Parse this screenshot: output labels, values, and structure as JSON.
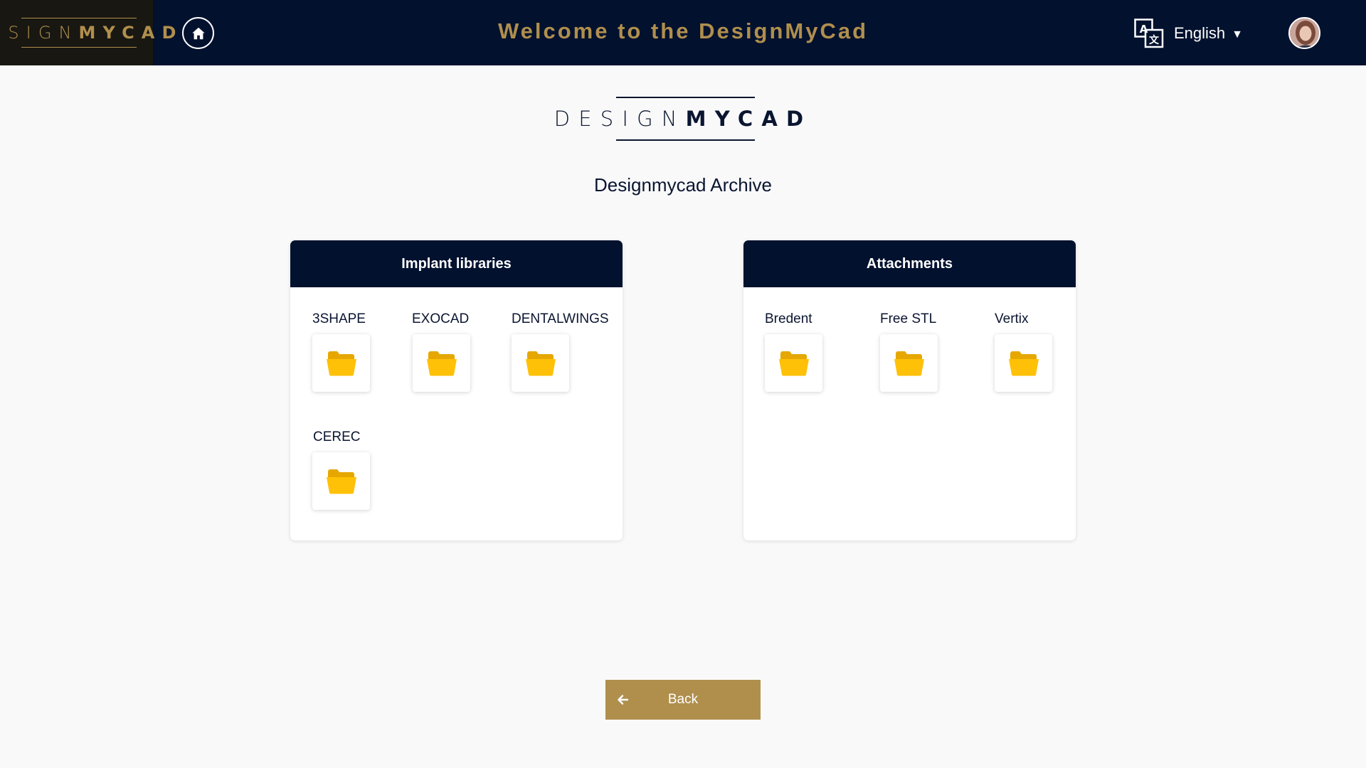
{
  "header": {
    "brand_logo": {
      "thin": "DESIGN",
      "bold": "MYCAD"
    },
    "title": "Welcome to the DesignMyCad",
    "language": {
      "label": "English",
      "icon": "translate-icon"
    },
    "home_icon": "home-icon",
    "avatar": "user-avatar"
  },
  "main": {
    "logo": {
      "thin": "DESIGN",
      "bold": "MYCAD"
    },
    "title": "Designmycad Archive",
    "cards": [
      {
        "title": "Implant libraries",
        "items": [
          {
            "label": "3SHAPE",
            "icon": "folder-icon"
          },
          {
            "label": "EXOCAD",
            "icon": "folder-icon"
          },
          {
            "label": "DENTALWINGS",
            "icon": "folder-icon"
          },
          {
            "label": "CEREC",
            "icon": "folder-icon"
          }
        ]
      },
      {
        "title": "Attachments",
        "items": [
          {
            "label": "Bredent",
            "icon": "folder-icon"
          },
          {
            "label": "Free STL",
            "icon": "folder-icon"
          },
          {
            "label": "Vertix",
            "icon": "folder-icon"
          }
        ]
      }
    ]
  },
  "back_button": {
    "label": "Back",
    "icon": "arrow-left-icon"
  },
  "colors": {
    "navy": "#01112e",
    "gold": "#b08f4d",
    "folder": "#ffc107",
    "background": "#f9f9f9"
  }
}
